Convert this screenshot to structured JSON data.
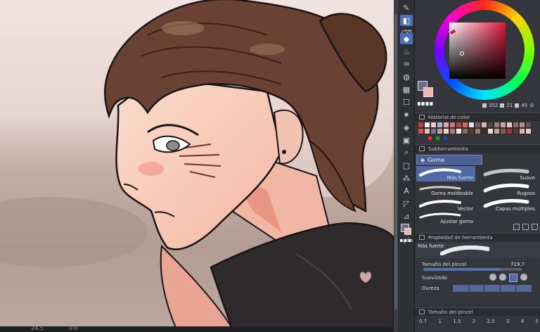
{
  "status": {
    "zoom": "24.5",
    "angle": "0.0"
  },
  "color_panel": {
    "hsv": {
      "h": "352",
      "s": "21",
      "v": "45"
    },
    "main_color": "#6d6f8a",
    "sub_color": "#f0b3b3"
  },
  "color_history": {
    "title": "Historial de color",
    "swatches": [
      "#c93c3c",
      "#ffffff",
      "#f3c9c9",
      "#a0b7d0",
      "#e8a49e",
      "#c07a7a",
      "#b4453e",
      "#e06060",
      "#e2e2e2",
      "#7a5e57",
      "#d9b4b0",
      "#4b4748",
      "#9f7d79",
      "#c5a8a5",
      "#efc6c3",
      "#8c6a66",
      "#b58e8b",
      "#6e5553",
      "#d85050",
      "#e9c1b6",
      "#6c7890",
      "#c59f95",
      "#f5d2c8",
      "#b5777a",
      "#ffe0d6",
      "#8a6b5e",
      "#523a33",
      "#a37862",
      "#3c2b26",
      "#f0dcd3",
      "#c4a093",
      "#7f5f53",
      "#ab2f2f",
      "#5a3c35",
      "#d7b4a6",
      "#efc9b8"
    ]
  },
  "subtool": {
    "title": "Subherramienta",
    "group": "Goma",
    "brushes": [
      {
        "label": "Más fuerte"
      },
      {
        "label": "Suave"
      },
      {
        "label": "Goma moldeable"
      },
      {
        "label": "Rugoso"
      },
      {
        "label": "Vector"
      },
      {
        "label": "Capas múltiples"
      },
      {
        "label": "Ajustar goma"
      }
    ]
  },
  "tool_property": {
    "title": "Propiedad de herramienta",
    "preset": "Más fuerte",
    "brush_size_label": "Tamaño del pincel",
    "brush_size_value": "719.7",
    "brush_size_fraction": 0.78,
    "smoothing_label": "Suavizado",
    "hardness_label": "Dureza"
  },
  "brush_size_panel": {
    "title": "Tamaño del pincel",
    "ticks": [
      "0.7",
      "1",
      "1.5",
      "2",
      "2.5",
      "3",
      "4",
      "5"
    ]
  },
  "tools": [
    "pen-icon",
    "cube-icon",
    "eraser-icon",
    "fill-icon",
    "smudge-icon",
    "flame-icon",
    "drops-icon",
    "grid-icon",
    "lasso-icon",
    "sparkle-icon",
    "bucket-icon",
    "gradient-icon",
    "move-icon",
    "select-icon",
    "magic-wand-icon",
    "text-icon",
    "vector-icon",
    "ruler-icon",
    "hand-icon",
    "eyedropper-icon"
  ]
}
